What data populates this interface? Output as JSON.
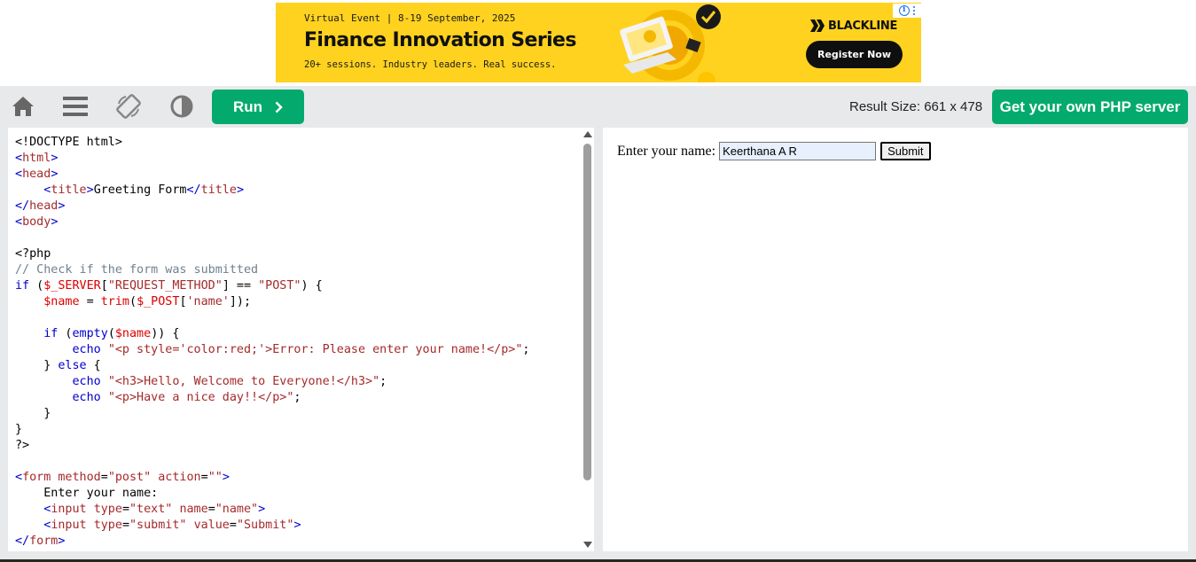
{
  "ad": {
    "event": "Virtual Event | 8-19 September, 2025",
    "title": "Finance Innovation Series",
    "tagline": "20+ sessions. Industry leaders. Real success.",
    "brand": "BLACKLINE",
    "cta": "Register Now",
    "choices_icon": "info-icon",
    "colors": {
      "background": "#ffd21f",
      "button": "#0f0f0f"
    }
  },
  "toolbar": {
    "icons": [
      "home-icon",
      "menu-icon",
      "rotate-icon",
      "contrast-icon"
    ],
    "run_label": "Run",
    "run_icon": "chevron-right-icon",
    "result_size": "Result Size: 661 x 478",
    "php_button": "Get your own PHP server",
    "accent": "#04aa6d"
  },
  "editor": {
    "lines": [
      [
        [
          "tx",
          "<!DOCTYPE html>"
        ]
      ],
      [
        [
          "br",
          "<"
        ],
        [
          "tag",
          "html"
        ],
        [
          "br",
          ">"
        ]
      ],
      [
        [
          "br",
          "<"
        ],
        [
          "tag",
          "head"
        ],
        [
          "br",
          ">"
        ]
      ],
      [
        [
          "tx",
          "    "
        ],
        [
          "br",
          "<"
        ],
        [
          "tag",
          "title"
        ],
        [
          "br",
          ">"
        ],
        [
          "tx",
          "Greeting Form"
        ],
        [
          "br",
          "</"
        ],
        [
          "tag",
          "title"
        ],
        [
          "br",
          ">"
        ]
      ],
      [
        [
          "br",
          "</"
        ],
        [
          "tag",
          "head"
        ],
        [
          "br",
          ">"
        ]
      ],
      [
        [
          "br",
          "<"
        ],
        [
          "tag",
          "body"
        ],
        [
          "br",
          ">"
        ]
      ],
      [],
      [
        [
          "tx",
          "<?php"
        ]
      ],
      [
        [
          "cm",
          "// Check if the form was submitted"
        ]
      ],
      [
        [
          "kw",
          "if"
        ],
        [
          "tx",
          " ("
        ],
        [
          "var",
          "$_SERVER"
        ],
        [
          "tx",
          "["
        ],
        [
          "str",
          "\"REQUEST_METHOD\""
        ],
        [
          "tx",
          "] == "
        ],
        [
          "str",
          "\"POST\""
        ],
        [
          "tx",
          ") {"
        ]
      ],
      [
        [
          "tx",
          "    "
        ],
        [
          "var",
          "$name"
        ],
        [
          "tx",
          " = "
        ],
        [
          "var",
          "trim"
        ],
        [
          "tx",
          "("
        ],
        [
          "var",
          "$_POST"
        ],
        [
          "tx",
          "["
        ],
        [
          "str",
          "'name'"
        ],
        [
          "tx",
          "]);"
        ]
      ],
      [],
      [
        [
          "tx",
          "    "
        ],
        [
          "kw",
          "if"
        ],
        [
          "tx",
          " ("
        ],
        [
          "kw",
          "empty"
        ],
        [
          "tx",
          "("
        ],
        [
          "var",
          "$name"
        ],
        [
          "tx",
          ")) {"
        ]
      ],
      [
        [
          "tx",
          "        "
        ],
        [
          "kw",
          "echo"
        ],
        [
          "tx",
          " "
        ],
        [
          "str",
          "\"<p style='color:red;'>Error: Please enter your name!</p>\""
        ],
        [
          "tx",
          ";"
        ]
      ],
      [
        [
          "tx",
          "    } "
        ],
        [
          "kw",
          "else"
        ],
        [
          "tx",
          " {"
        ]
      ],
      [
        [
          "tx",
          "        "
        ],
        [
          "kw",
          "echo"
        ],
        [
          "tx",
          " "
        ],
        [
          "str",
          "\"<h3>Hello, Welcome to Everyone!</h3>\""
        ],
        [
          "tx",
          ";"
        ]
      ],
      [
        [
          "tx",
          "        "
        ],
        [
          "kw",
          "echo"
        ],
        [
          "tx",
          " "
        ],
        [
          "str",
          "\"<p>Have a nice day!!</p>\""
        ],
        [
          "tx",
          ";"
        ]
      ],
      [
        [
          "tx",
          "    }"
        ]
      ],
      [
        [
          "tx",
          "}"
        ]
      ],
      [
        [
          "tx",
          "?>"
        ]
      ],
      [],
      [
        [
          "br",
          "<"
        ],
        [
          "tag",
          "form"
        ],
        [
          "tx",
          " "
        ],
        [
          "attr",
          "method"
        ],
        [
          "tx",
          "="
        ],
        [
          "str",
          "\"post\""
        ],
        [
          "tx",
          " "
        ],
        [
          "attr",
          "action"
        ],
        [
          "tx",
          "="
        ],
        [
          "str",
          "\"\""
        ],
        [
          "br",
          ">"
        ]
      ],
      [
        [
          "tx",
          "    Enter your name:"
        ]
      ],
      [
        [
          "tx",
          "    "
        ],
        [
          "br",
          "<"
        ],
        [
          "tag",
          "input"
        ],
        [
          "tx",
          " "
        ],
        [
          "attr",
          "type"
        ],
        [
          "tx",
          "="
        ],
        [
          "str",
          "\"text\""
        ],
        [
          "tx",
          " "
        ],
        [
          "attr",
          "name"
        ],
        [
          "tx",
          "="
        ],
        [
          "str",
          "\"name\""
        ],
        [
          "br",
          ">"
        ]
      ],
      [
        [
          "tx",
          "    "
        ],
        [
          "br",
          "<"
        ],
        [
          "tag",
          "input"
        ],
        [
          "tx",
          " "
        ],
        [
          "attr",
          "type"
        ],
        [
          "tx",
          "="
        ],
        [
          "str",
          "\"submit\""
        ],
        [
          "tx",
          " "
        ],
        [
          "attr",
          "value"
        ],
        [
          "tx",
          "="
        ],
        [
          "str",
          "\"Submit\""
        ],
        [
          "br",
          ">"
        ]
      ],
      [
        [
          "br",
          "</"
        ],
        [
          "tag",
          "form"
        ],
        [
          "br",
          ">"
        ]
      ]
    ]
  },
  "result": {
    "label": "Enter your name:",
    "input_value": "Keerthana A R",
    "submit_label": "Submit"
  }
}
